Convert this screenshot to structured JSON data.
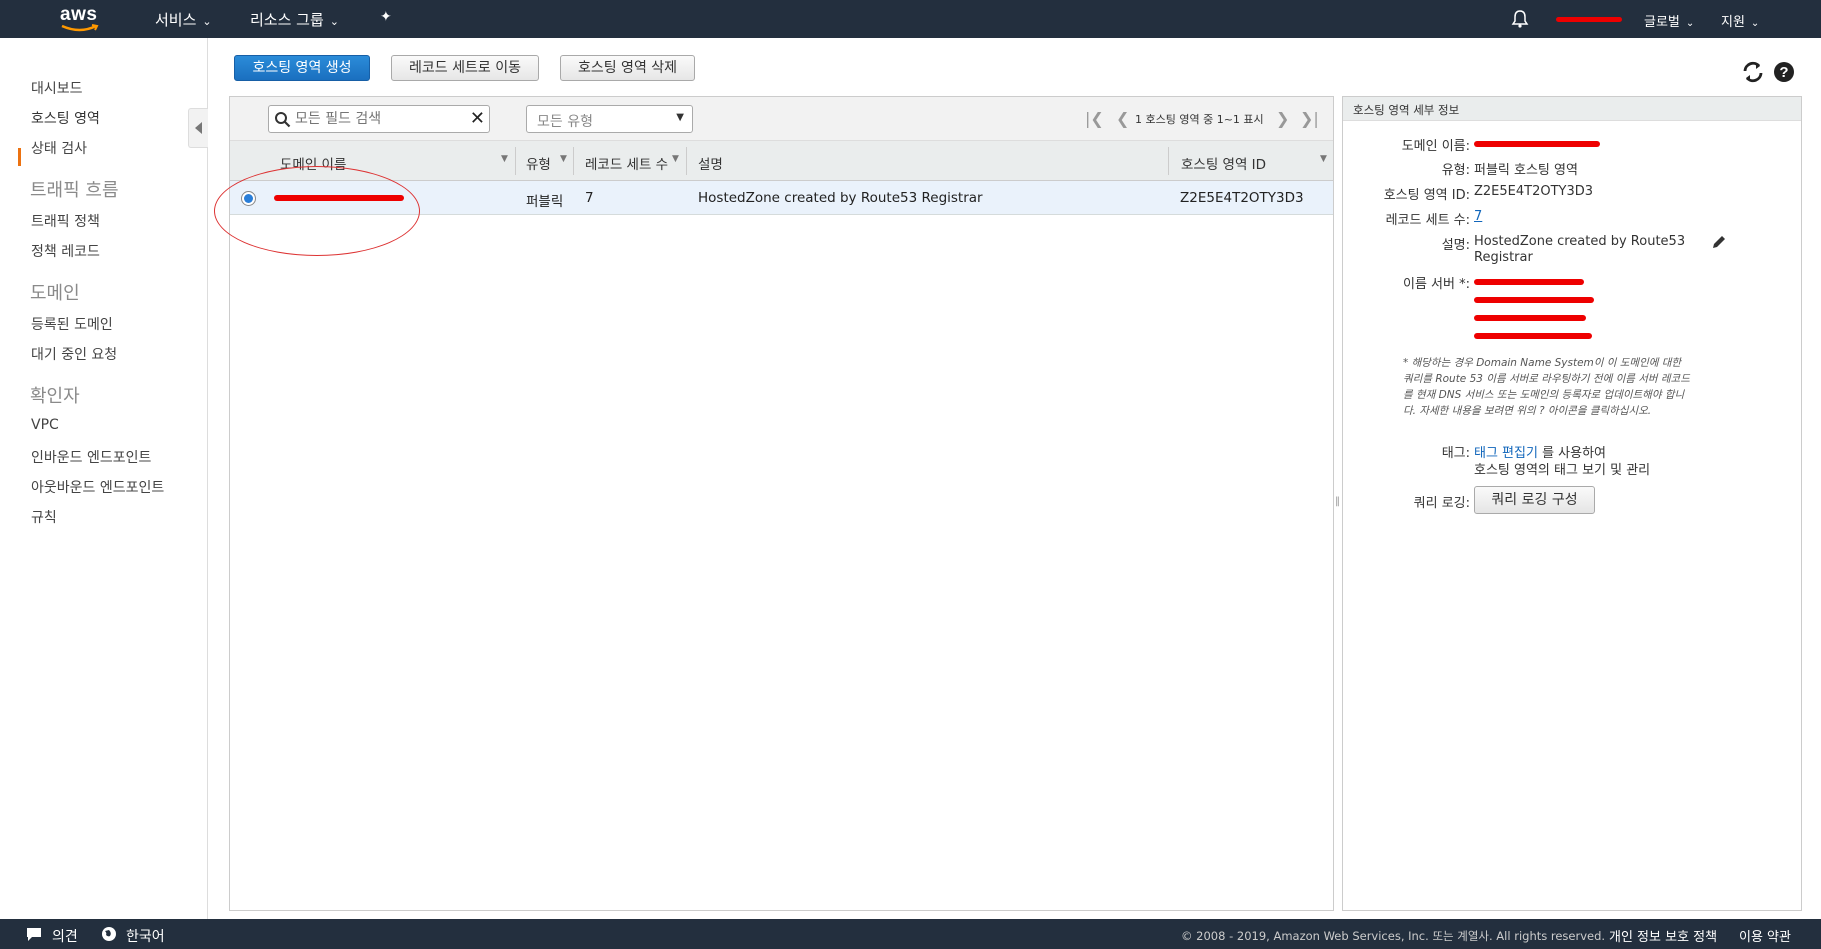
{
  "topnav": {
    "logo_text": "aws",
    "services_label": "서비스",
    "resource_groups_label": "리소스 그룹",
    "region_label": "글로벌",
    "support_label": "지원"
  },
  "sidebar": {
    "dashboard": "대시보드",
    "hosted_zones": "호스팅 영역",
    "health_checks": "상태 검사",
    "traffic_flow_section": "트래픽 흐름",
    "traffic_policies": "트래픽 정책",
    "policy_records": "정책 레코드",
    "domains_section": "도메인",
    "registered_domains": "등록된 도메인",
    "pending_requests": "대기 중인 요청",
    "resolver_section": "확인자",
    "vpc": "VPC",
    "inbound_endpoints": "인바운드 엔드포인트",
    "outbound_endpoints": "아웃바운드 엔드포인트",
    "rules": "규칙"
  },
  "toolbar": {
    "create_zone": "호스팅 영역 생성",
    "go_to_records": "레코드 세트로 이동",
    "delete_zone": "호스팅 영역 삭제"
  },
  "grid": {
    "search_placeholder": "모든 필드 검색",
    "type_filter": "모든 유형",
    "pager_text": "1 호스팅 영역 중 1~1 표시",
    "columns": {
      "domain": "도메인 이름",
      "type": "유형",
      "record_count": "레코드 세트 수",
      "description": "설명",
      "zone_id": "호스팅 영역 ID"
    },
    "rows": [
      {
        "type": "퍼블릭",
        "record_count": "7",
        "description": "HostedZone created by Route53 Registrar",
        "zone_id": "Z2E5E4T2OTY3D3"
      }
    ]
  },
  "detail": {
    "header": "호스팅 영역 세부 정보",
    "domain_label": "도메인 이름:",
    "type_label": "유형:",
    "type_value": "퍼블릭 호스팅 영역",
    "zone_id_label": "호스팅 영역 ID:",
    "zone_id_value": "Z2E5E4T2OTY3D3",
    "record_count_label": "레코드 세트 수:",
    "record_count_value": "7",
    "description_label": "설명:",
    "description_line1": "HostedZone created by Route53",
    "description_line2": "Registrar",
    "name_servers_label": "이름 서버 *:",
    "note": "* 해당하는 경우 Domain Name System이 이 도메인에 대한 쿼리를 Route 53 이름 서버로 라우팅하기 전에 이름 서버 레코드를 현재 DNS 서비스 또는 도메인의 등록자로 업데이트해야 합니다. 자세한 내용을 보려면 위의 ? 아이콘을 클릭하십시오.",
    "tags_label": "태그:",
    "tags_link": "태그 편집기",
    "tags_suffix": "를 사용하여",
    "tags_line2": "호스팅 영역의 태그 보기 및 관리",
    "query_logging_label": "쿼리 로깅:",
    "query_logging_button": "쿼리 로깅 구성"
  },
  "footer": {
    "feedback": "의견",
    "language": "한국어",
    "copyright": "© 2008 - 2019, Amazon Web Services, Inc. 또는 계열사. All rights reserved.",
    "privacy": "개인 정보 보호 정책",
    "terms": "이용 약관"
  },
  "colors": {
    "nav_bg": "#232f3e",
    "primary_button": "#1a6fbf",
    "active_accent": "#ec7211",
    "selected_row": "#eaf2fb",
    "redaction": "#e00000"
  }
}
